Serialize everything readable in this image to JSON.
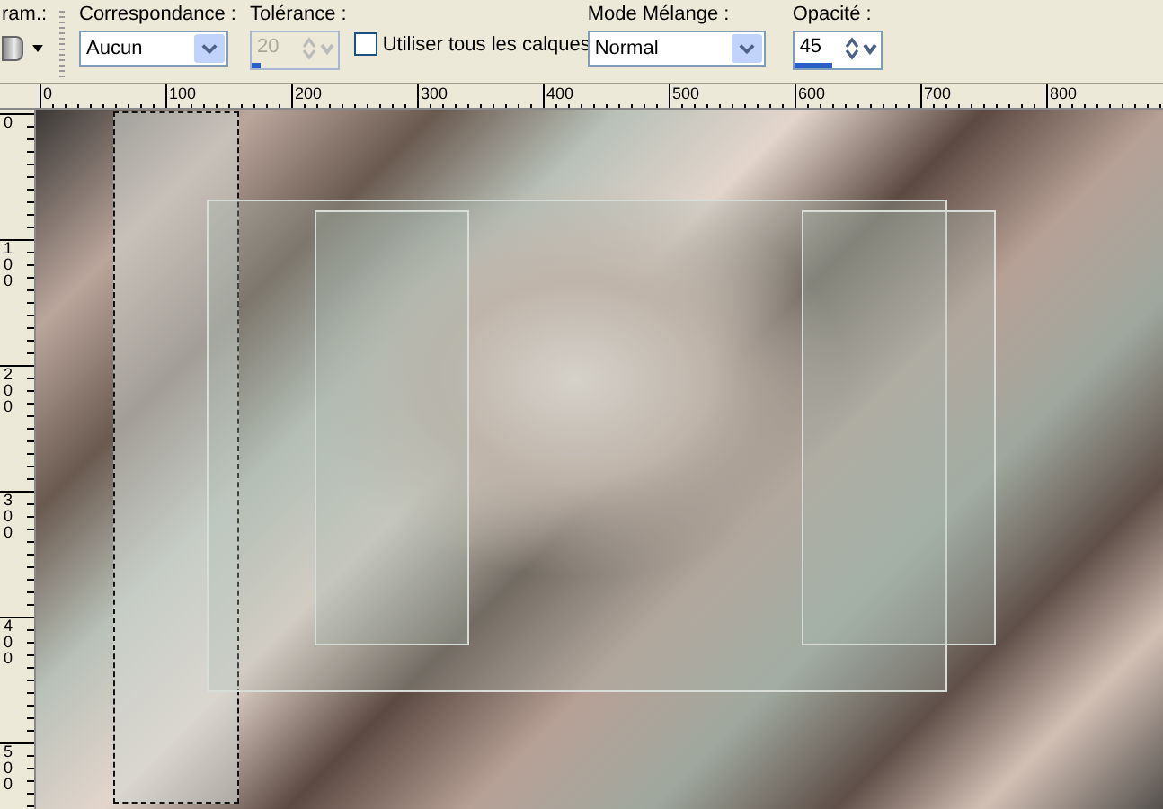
{
  "toolbar": {
    "cut_label": "ram.:",
    "match_mode": {
      "label": "Correspondance :",
      "value": "Aucun"
    },
    "tolerance": {
      "label": "Tolérance :",
      "value": "20",
      "disabled": true,
      "level": 0.1
    },
    "use_all_layers": {
      "label": "Utiliser tous les calques",
      "checked": false
    },
    "blend_mode": {
      "label": "Mode Mélange :",
      "value": "Normal"
    },
    "opacity": {
      "label": "Opacité :",
      "value": "45",
      "disabled": false,
      "level": 0.45
    }
  },
  "ruler_horizontal": [
    "0",
    "100",
    "200",
    "300",
    "400",
    "500",
    "600",
    "700",
    "800"
  ],
  "ruler_vertical": [
    "0",
    "100",
    "200",
    "300",
    "400",
    "500"
  ],
  "canvas": {
    "selection": true
  }
}
